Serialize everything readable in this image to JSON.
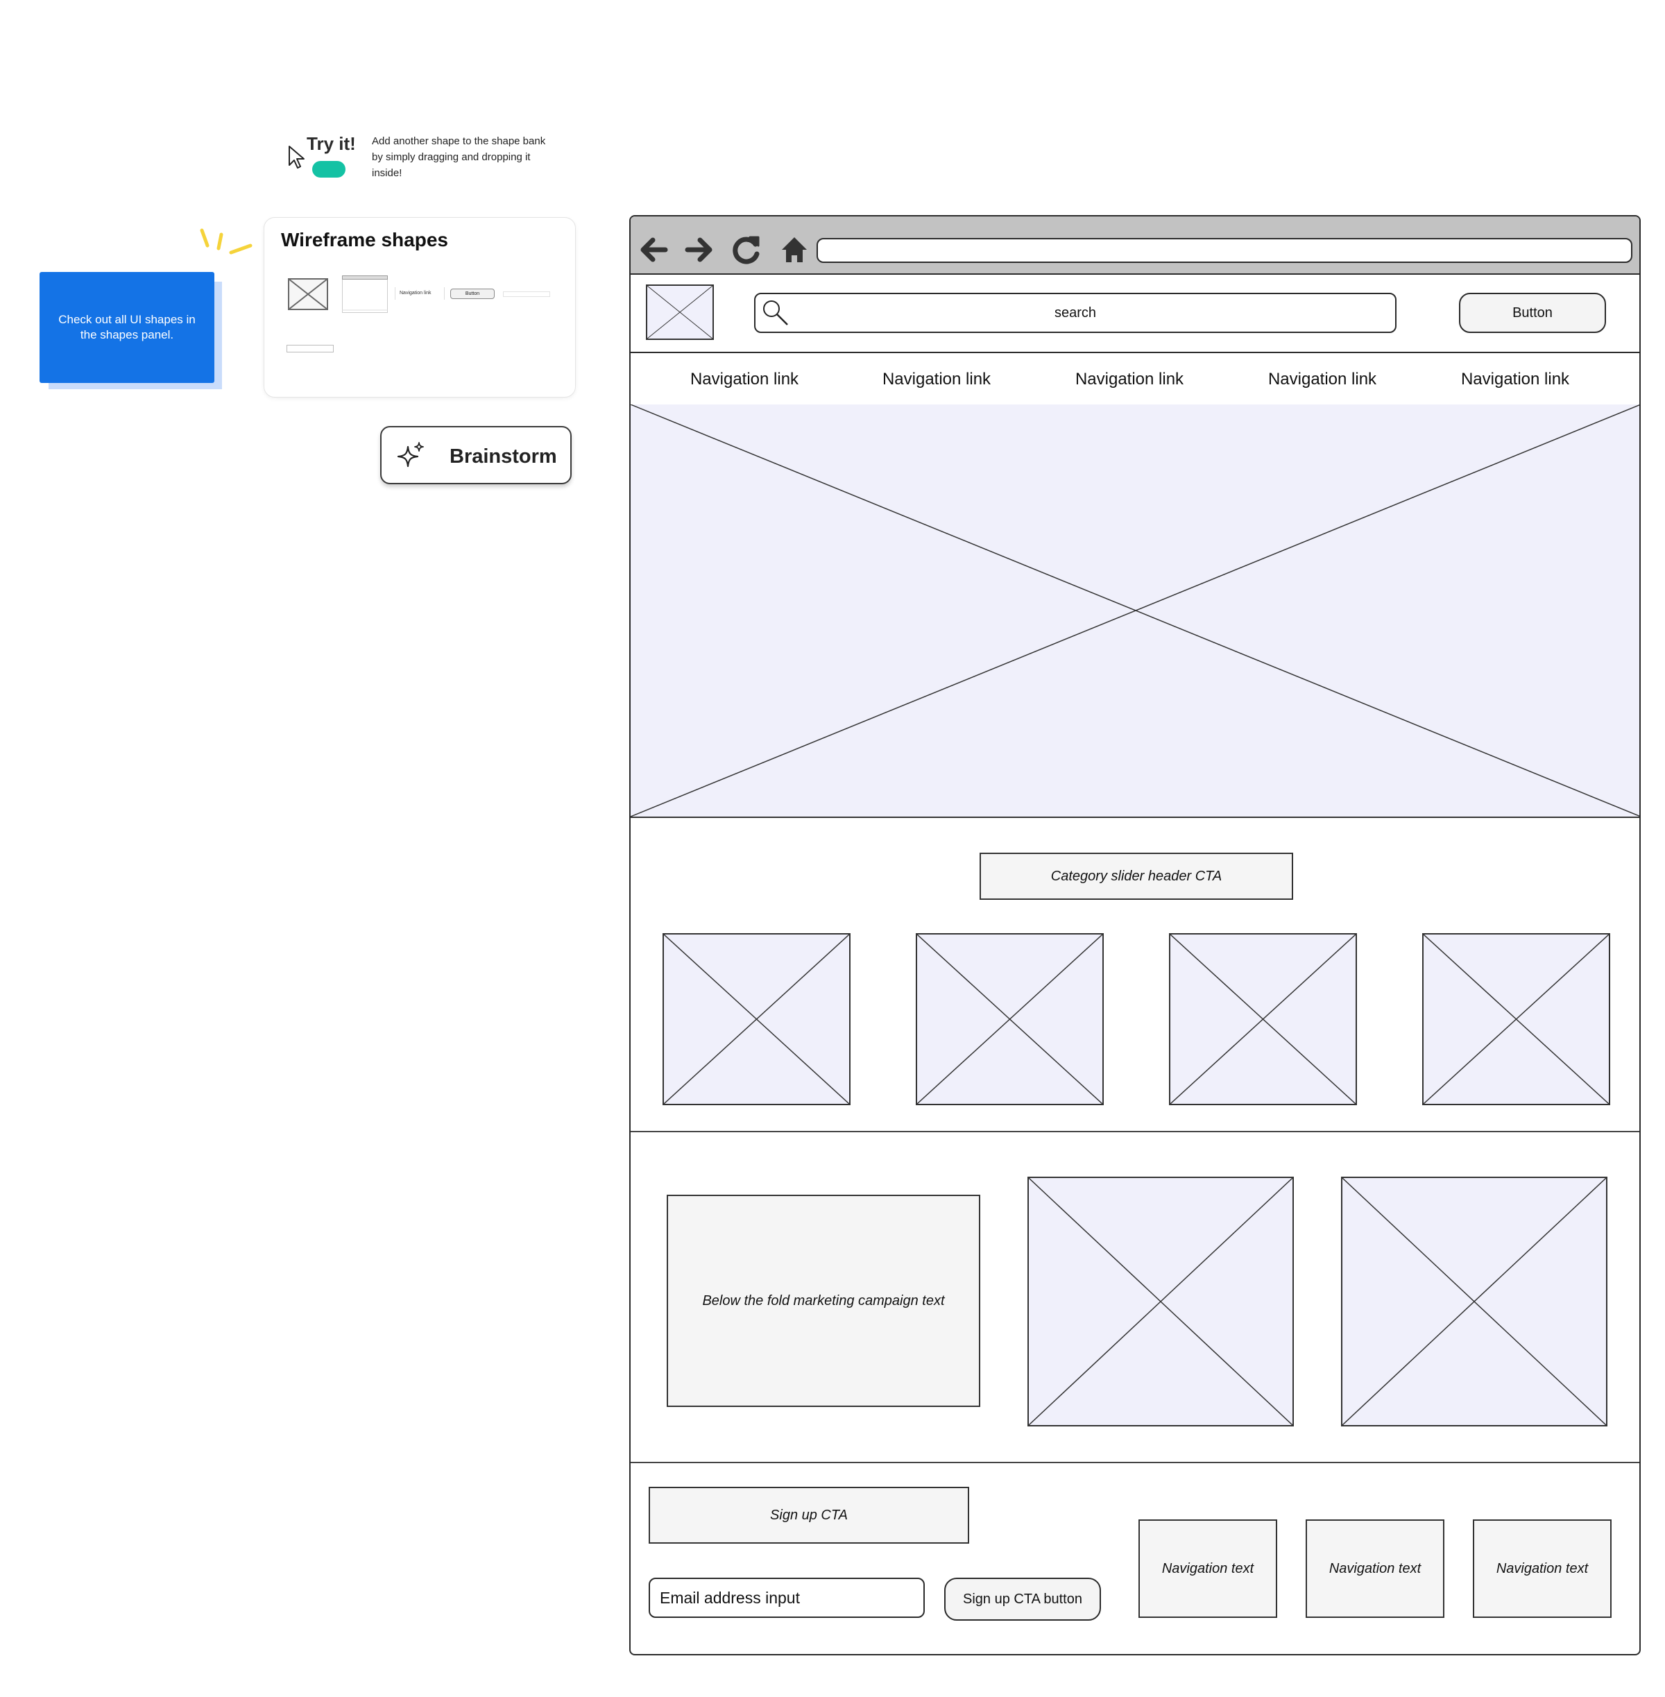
{
  "try_it": {
    "title": "Try it!",
    "description": "Add another shape to the shape bank by simply dragging and dropping it inside!",
    "toggle_color": "#14c2a4"
  },
  "tip_card": {
    "text": "Check out all UI shapes in the shapes panel.",
    "color": "#1473e6"
  },
  "shapes_panel": {
    "title": "Wireframe shapes",
    "mini_nav_label": "Navigation link",
    "mini_button_label": "Button"
  },
  "brainstorm": {
    "label": "Brainstorm",
    "icon": "sparkle-icon"
  },
  "browser": {
    "toolbar_icons": [
      "back-arrow-icon",
      "forward-arrow-icon",
      "reload-icon",
      "home-icon"
    ],
    "search_placeholder": "search",
    "header_button": "Button",
    "nav_links": [
      "Navigation link",
      "Navigation link",
      "Navigation link",
      "Navigation link",
      "Navigation link"
    ],
    "category_header": "Category slider header CTA",
    "marketing_text": "Below the fold marketing campaign text",
    "signup_cta": "Sign up CTA",
    "email_input": "Email address input",
    "signup_button": "Sign up CTA button",
    "footer_nav": [
      "Navigation text",
      "Navigation text",
      "Navigation text"
    ],
    "placeholder_fill": "#f0f0fb"
  }
}
